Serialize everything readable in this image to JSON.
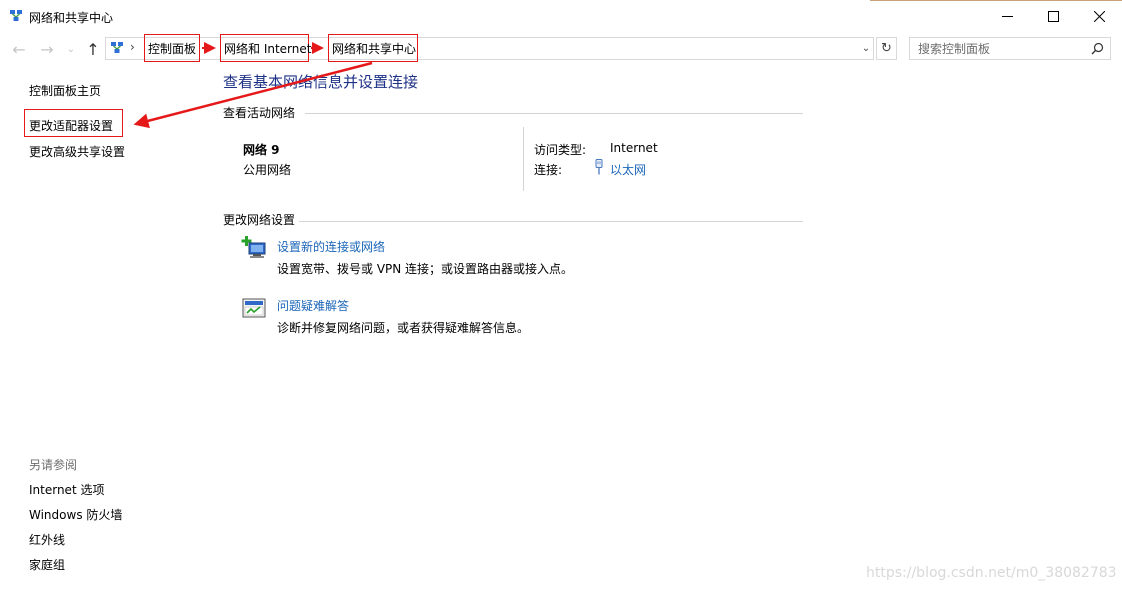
{
  "window": {
    "title": "网络和共享中心",
    "icon": "network-icon",
    "controls": {
      "minimize": "—",
      "maximize": "☐",
      "close": "✕"
    }
  },
  "nav": {
    "back": "←",
    "forward": "→",
    "recent": "⌄",
    "up": "↑",
    "separator": "›",
    "breadcrumbs": [
      "控制面板",
      "网络和 Internet",
      "网络和共享中心"
    ],
    "dropdown": "⌄",
    "refresh": "↻",
    "search_placeholder": "搜索控制面板"
  },
  "sidebar": {
    "items": [
      "控制面板主页",
      "更改适配器设置",
      "更改高级共享设置"
    ],
    "see_also_title": "另请参阅",
    "see_also": [
      "Internet 选项",
      "Windows 防火墙",
      "红外线",
      "家庭组"
    ]
  },
  "main": {
    "heading": "查看基本网络信息并设置连接",
    "active_section": "查看活动网络",
    "network": {
      "name": "网络  9",
      "type": "公用网络",
      "access_label": "访问类型:",
      "access_value": "Internet",
      "conn_label": "连接:",
      "conn_value": "以太网"
    },
    "change_section": "更改网络设置",
    "tasks": [
      {
        "link": "设置新的连接或网络",
        "desc": "设置宽带、拨号或 VPN 连接；或设置路由器或接入点。"
      },
      {
        "link": "问题疑难解答",
        "desc": "诊断并修复网络问题，或者获得疑难解答信息。"
      }
    ]
  },
  "watermark": "https://blog.csdn.net/m0_38082783",
  "colors": {
    "annotation_red": "#e51919",
    "link_blue": "#1a66b8",
    "heading_blue": "#1e3287"
  }
}
